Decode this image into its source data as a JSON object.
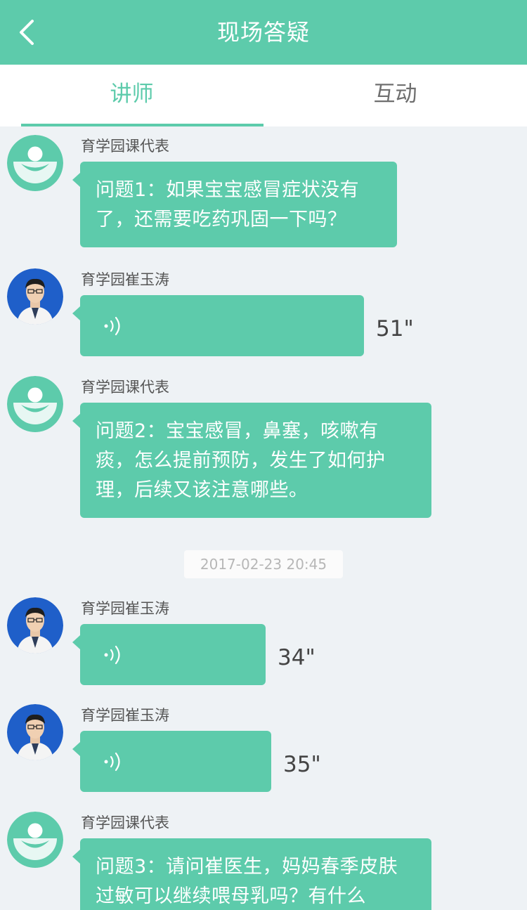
{
  "header": {
    "back_icon": "chevron-left-icon",
    "title": "现场答疑"
  },
  "tabs": [
    {
      "label": "讲师",
      "active": true
    },
    {
      "label": "互动",
      "active": false
    }
  ],
  "colors": {
    "accent": "#5dcbab",
    "background": "#eef2f5",
    "lecturer_avatar_bg": "#1f5fc9"
  },
  "feed": {
    "timestamp": "2017-02-23 20:45",
    "messages": [
      {
        "sender": "育学园课代表",
        "type": "text",
        "text": "问题1：如果宝宝感冒症状没有了，还需要吃药巩固一下吗？"
      },
      {
        "sender": "育学园崔玉涛",
        "type": "voice",
        "duration": "51\""
      },
      {
        "sender": "育学园课代表",
        "type": "text",
        "text": "问题2：宝宝感冒，鼻塞，咳嗽有痰，怎么提前预防，发生了如何护理，后续又该注意哪些。"
      },
      {
        "sender": "育学园崔玉涛",
        "type": "voice",
        "duration": "34\""
      },
      {
        "sender": "育学园崔玉涛",
        "type": "voice",
        "duration": "35\""
      },
      {
        "sender": "育学园课代表",
        "type": "text",
        "text": "问题3：请问崔医生，妈妈春季皮肤过敏可以继续喂母乳吗？有什么"
      }
    ]
  }
}
